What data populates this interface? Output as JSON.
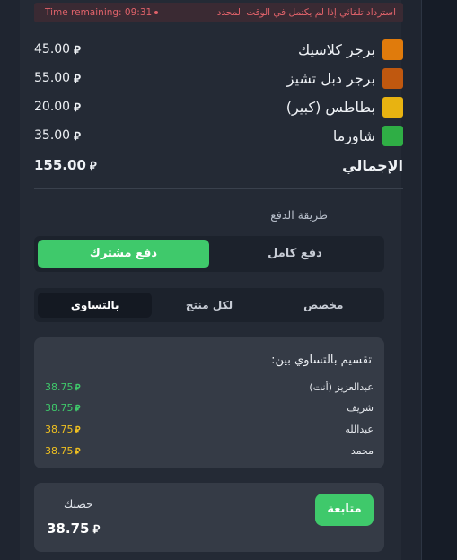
{
  "banner": {
    "timer": "Time remaining: 09:31",
    "note": "استرداد تلقائي إذا لم يكتمل في الوقت المحدد"
  },
  "currency_symbol": "⃁",
  "items": [
    {
      "name": "برجر كلاسيك",
      "price": "45.00",
      "color": "#e07b0c"
    },
    {
      "name": "برجر دبل تشيز",
      "price": "55.00",
      "color": "#c0580f"
    },
    {
      "name": "بطاطس (كبير)",
      "price": "20.00",
      "color": "#e8b311"
    },
    {
      "name": "شاورما",
      "price": "35.00",
      "color": "#2fae45"
    }
  ],
  "total": {
    "label": "الإجمالي",
    "price": "155.00"
  },
  "payment": {
    "label": "طريقة الدفع",
    "modes": {
      "full": "دفع كامل",
      "shared": "دفع مشترك",
      "selected": "shared"
    },
    "split_modes": {
      "custom": "مخصص",
      "per_item": "لكل منتج",
      "equal": "بالتساوي",
      "selected": "equal"
    }
  },
  "split": {
    "title": "تقسيم بالتساوي بين:",
    "people": [
      {
        "name": "عبدالعزيز (أنت)",
        "amount": "38.75",
        "color": "#3fc96b"
      },
      {
        "name": "شريف",
        "amount": "38.75",
        "color": "#3fc96b"
      },
      {
        "name": "عبدالله",
        "amount": "38.75",
        "color": "#f0c020"
      },
      {
        "name": "محمد",
        "amount": "38.75",
        "color": "#f0c020"
      }
    ]
  },
  "share": {
    "label": "حصتك",
    "amount": "38.75",
    "continue": "متابعة"
  }
}
